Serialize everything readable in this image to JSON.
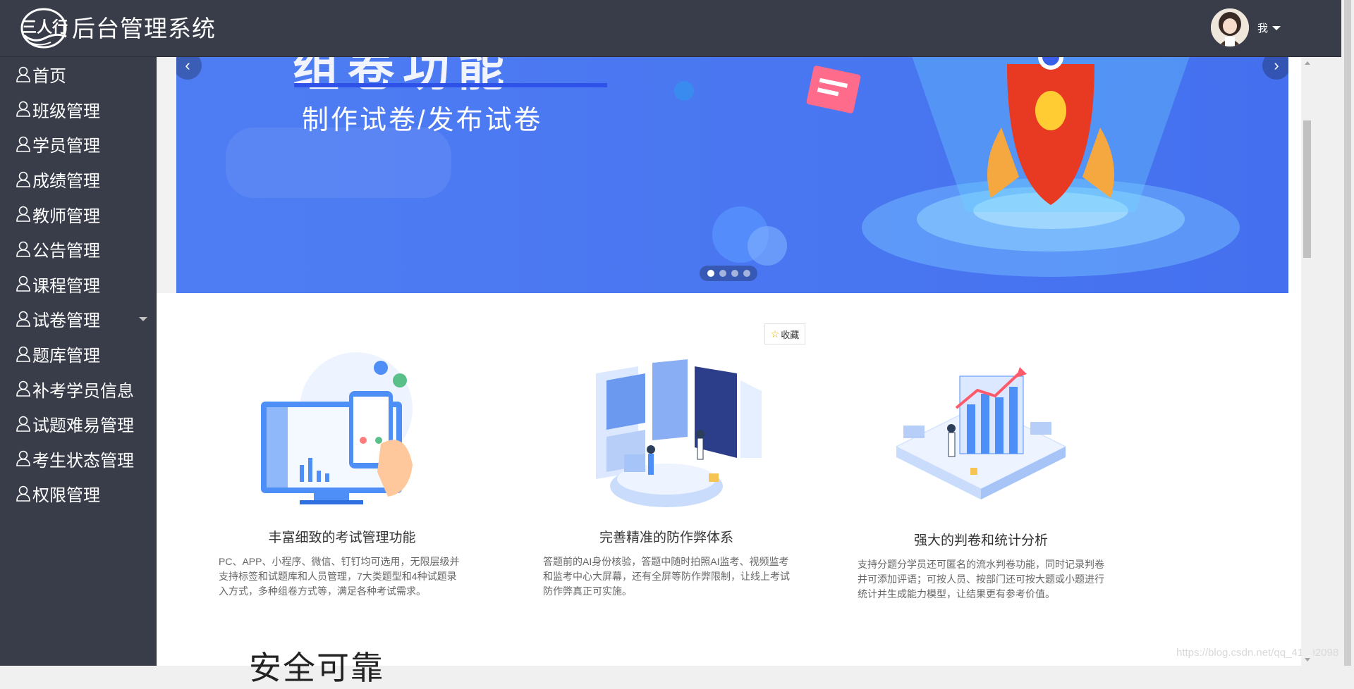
{
  "app": {
    "title": "后台管理系统",
    "logo_label": "三人行"
  },
  "header": {
    "user_name": "我"
  },
  "sidebar": {
    "items": [
      {
        "label": "首页"
      },
      {
        "label": "班级管理"
      },
      {
        "label": "学员管理"
      },
      {
        "label": "成绩管理"
      },
      {
        "label": "教师管理"
      },
      {
        "label": "公告管理"
      },
      {
        "label": "课程管理"
      },
      {
        "label": "试卷管理",
        "has_submenu": true
      },
      {
        "label": "题库管理"
      },
      {
        "label": "补考学员信息"
      },
      {
        "label": "试题难易管理"
      },
      {
        "label": "考生状态管理"
      },
      {
        "label": "权限管理"
      }
    ]
  },
  "banner": {
    "heading": "组卷功能",
    "subtitle": "制作试卷/发布试卷",
    "slide_count": 4,
    "active_slide": 1
  },
  "collect": {
    "label": "收藏"
  },
  "features": [
    {
      "title": "丰富细致的考试管理功能",
      "desc": "PC、APP、小程序、微信、钉钉均可选用，无限层级并支持标签和试题库和人员管理，7大类题型和4种试题录入方式，多种组卷方式等，满足各种考试需求。"
    },
    {
      "title": "完善精准的防作弊体系",
      "desc": "答题前的AI身份核验，答题中随时拍照AI监考、视频监考和监考中心大屏幕，还有全屏等防作弊限制，让线上考试防作弊真正可实施。"
    },
    {
      "title": "强大的判卷和统计分析",
      "desc": "支持分题分学员还可匿名的流水判卷功能，同时记录判卷并可添加评语；可按人员、按部门还可按大题或小题进行统计并生成能力模型，让结果更有参考价值。"
    }
  ],
  "section": {
    "title": "安全可靠"
  },
  "watermark": "https://blog.csdn.net/qq_41592098",
  "colors": {
    "sidebar_bg": "#393d49",
    "banner_blue": "#4a77f1",
    "text_dark": "#333333"
  }
}
